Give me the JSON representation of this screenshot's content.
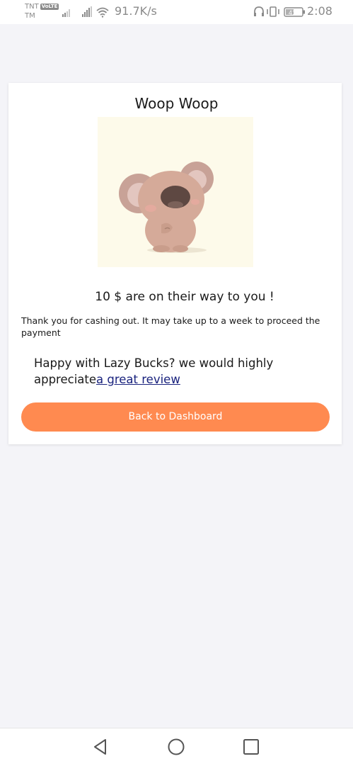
{
  "status_bar": {
    "carrier_line1": "TNT",
    "carrier_badge": "VoLTE",
    "carrier_line2": "TM",
    "net_speed": "91.7K/s",
    "battery_level": "41",
    "time": "2:08"
  },
  "card": {
    "title": "Woop Woop",
    "illustration_icon": "koala-illustration",
    "amount_message": "10 $ are on their way to you !",
    "info_message": "Thank you for cashing out. It may take up to a week to proceed the payment",
    "review_prompt": "Happy with Lazy Bucks? we would highly appreciate",
    "review_link_label": "a great review",
    "dashboard_button_label": "Back to Dashboard"
  },
  "nav_bar": {
    "back_icon": "back-triangle-icon",
    "home_icon": "home-circle-icon",
    "recents_icon": "recents-square-icon"
  },
  "colors": {
    "accent_button": "#ff8a50",
    "link": "#1a237e",
    "page_background": "#f4f4f8",
    "card_background": "#ffffff"
  }
}
